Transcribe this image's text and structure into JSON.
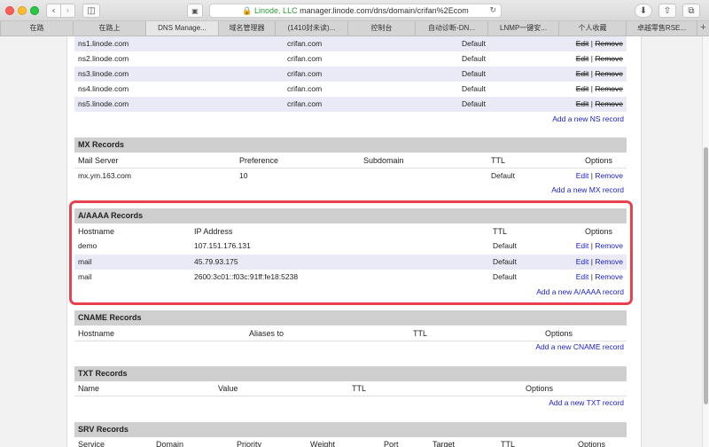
{
  "browser": {
    "url_owner": "Linode, LLC",
    "url_text": "manager.linode.com/dns/domain/crifan%2Ecom",
    "tabs": [
      "在路",
      "在路上",
      "DNS Manage...",
      "域名管理器",
      "(1410封未读)...",
      "控制台",
      "自动诊断-DN...",
      "LNMP一键安...",
      "个人收藏",
      "卓越零售RSE..."
    ],
    "active_tab": 2
  },
  "ns": {
    "rows": [
      {
        "name": "ns1.linode.com",
        "subdomain": "crifan.com",
        "ttl": "Default"
      },
      {
        "name": "ns2.linode.com",
        "subdomain": "crifan.com",
        "ttl": "Default"
      },
      {
        "name": "ns3.linode.com",
        "subdomain": "crifan.com",
        "ttl": "Default"
      },
      {
        "name": "ns4.linode.com",
        "subdomain": "crifan.com",
        "ttl": "Default"
      },
      {
        "name": "ns5.linode.com",
        "subdomain": "crifan.com",
        "ttl": "Default"
      }
    ],
    "edit_label": "Edit",
    "remove_label": "Remove",
    "sep": "|",
    "add_link": "Add a new NS record"
  },
  "mx": {
    "title": "MX Records",
    "columns": [
      "Mail Server",
      "Preference",
      "Subdomain",
      "TTL",
      "Options"
    ],
    "rows": [
      {
        "server": "mx.ym.163.com",
        "preference": "10",
        "subdomain": "",
        "ttl": "Default"
      }
    ],
    "add_link": "Add a new MX record"
  },
  "a": {
    "title": "A/AAAA Records",
    "columns": [
      "Hostname",
      "IP Address",
      "TTL",
      "Options"
    ],
    "rows": [
      {
        "host": "demo",
        "ip": "107.151.176.131",
        "ttl": "Default"
      },
      {
        "host": "mail",
        "ip": "45.79.93.175",
        "ttl": "Default"
      },
      {
        "host": "mail",
        "ip": "2600:3c01::f03c:91ff:fe18:5238",
        "ttl": "Default"
      }
    ],
    "add_link": "Add a new A/AAAA record"
  },
  "cname": {
    "title": "CNAME Records",
    "columns": [
      "Hostname",
      "Aliases to",
      "TTL",
      "Options"
    ],
    "add_link": "Add a new CNAME record"
  },
  "txt": {
    "title": "TXT Records",
    "columns": [
      "Name",
      "Value",
      "TTL",
      "Options"
    ],
    "add_link": "Add a new TXT record"
  },
  "srv": {
    "title": "SRV Records",
    "columns": [
      "Service",
      "Domain",
      "Priority",
      "Weight",
      "Port",
      "Target",
      "TTL",
      "Options"
    ]
  },
  "common": {
    "edit": "Edit",
    "remove": "Remove",
    "sep": "|"
  },
  "colors": {
    "link": "#1a1fc9",
    "highlight": "#e8424f",
    "alt_row": "#eaeaf6",
    "header": "#cfcfcf"
  }
}
